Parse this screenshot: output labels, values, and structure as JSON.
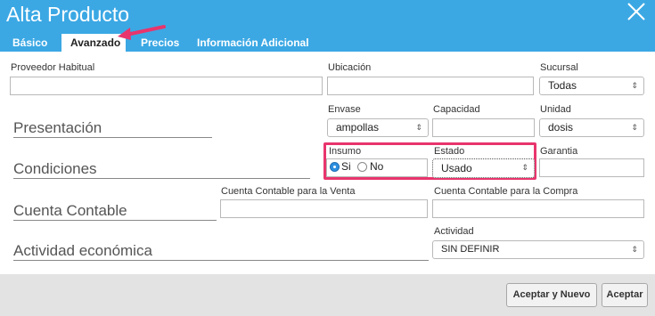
{
  "dialog": {
    "title": "Alta Producto"
  },
  "tabs": [
    {
      "label": "Básico"
    },
    {
      "label": "Avanzado",
      "active": true
    },
    {
      "label": "Precios"
    },
    {
      "label": "Información Adicional"
    }
  ],
  "fields": {
    "proveedor_habitual": {
      "label": "Proveedor Habitual",
      "value": ""
    },
    "ubicacion": {
      "label": "Ubicación",
      "value": ""
    },
    "sucursal": {
      "label": "Sucursal",
      "value": "Todas"
    },
    "envase": {
      "label": "Envase",
      "value": "ampollas"
    },
    "capacidad": {
      "label": "Capacidad",
      "value": ""
    },
    "unidad": {
      "label": "Unidad",
      "value": "dosis"
    },
    "insumo": {
      "label": "Insumo",
      "options": [
        "Si",
        "No"
      ],
      "selected": "Si"
    },
    "estado": {
      "label": "Estado",
      "value": "Usado"
    },
    "garantia": {
      "label": "Garantia",
      "value": ""
    },
    "cuenta_venta": {
      "label": "Cuenta Contable para la Venta",
      "value": ""
    },
    "cuenta_compra": {
      "label": "Cuenta Contable para la Compra",
      "value": ""
    },
    "actividad": {
      "label": "Actividad",
      "value": "SIN DEFINIR"
    }
  },
  "sections": {
    "presentacion": "Presentación",
    "condiciones": "Condiciones",
    "cuenta_contable": "Cuenta Contable",
    "actividad_economica": "Actividad económica"
  },
  "buttons": {
    "aceptar_y_nuevo": "Aceptar y Nuevo",
    "aceptar": "Aceptar"
  },
  "colors": {
    "header": "#3ba8e4",
    "highlight": "#e8356d",
    "annotation_arrow": "#e8356d",
    "footer": "#e3e3e3"
  }
}
